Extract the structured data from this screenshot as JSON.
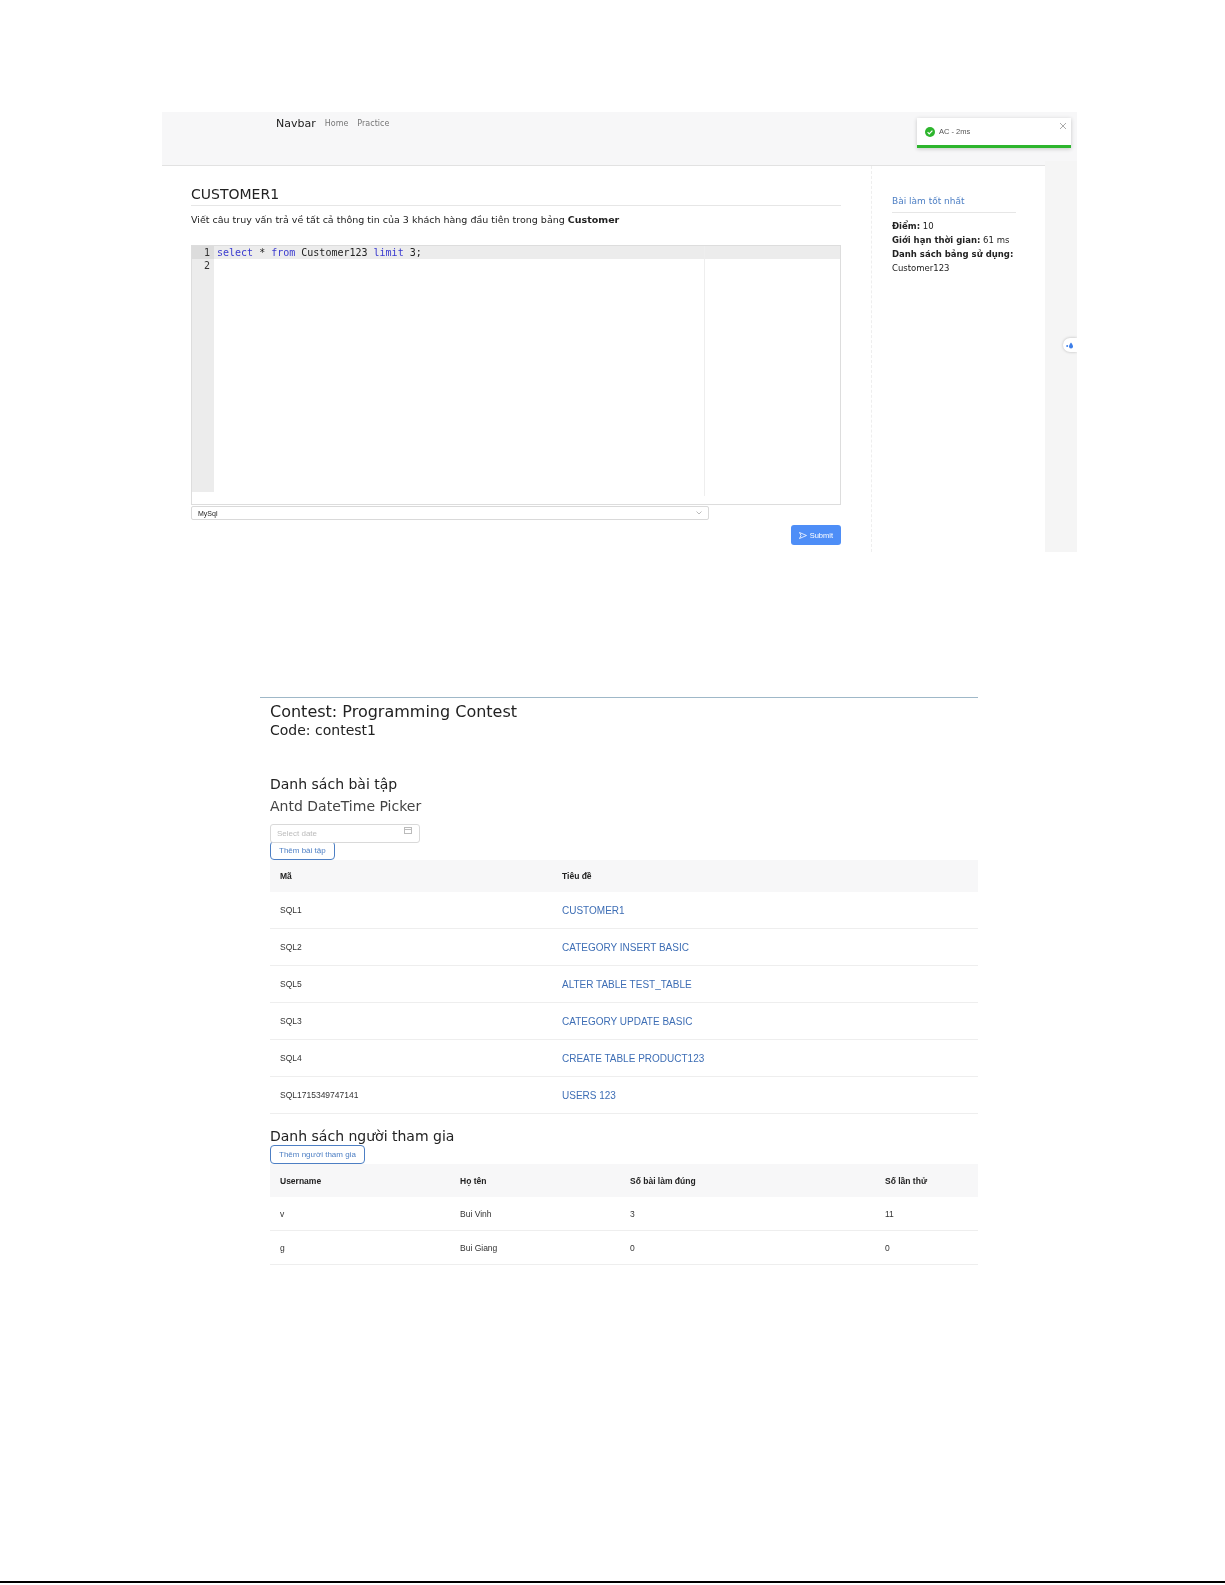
{
  "practice_screen": {
    "navbar": {
      "brand": "Navbar",
      "links": [
        {
          "label": "Home"
        },
        {
          "label": "Practice"
        }
      ]
    },
    "toast": {
      "kind": "success",
      "message": "AC - 2ms"
    },
    "problem": {
      "title": "CUSTOMER1",
      "description": "Viết câu truy vấn trả về tất cả thông tin của 3 khách hàng đầu tiên trong bảng **Customer**"
    },
    "editor": {
      "lines": [
        {
          "number": "1",
          "active": true,
          "tokens": [
            {
              "kind": "keyword",
              "text": "select"
            },
            {
              "kind": "plain",
              "text": " * "
            },
            {
              "kind": "keyword",
              "text": "from"
            },
            {
              "kind": "plain",
              "text": " Customer123 "
            },
            {
              "kind": "keyword",
              "text": "limit"
            },
            {
              "kind": "plain",
              "text": " 3;"
            }
          ]
        },
        {
          "number": "2",
          "active": false
        }
      ]
    },
    "language_select": {
      "value": "MySql"
    },
    "submit_button": {
      "label": "Submit"
    },
    "best_submission": {
      "title": "Bài làm tốt nhất",
      "lines": [
        "**Điểm:** 10",
        "**Giới hạn thời gian:** 61 ms",
        "**Danh sách bảng sử dụng:** Customer123"
      ]
    }
  },
  "contest_screen": {
    "title": "Contest: Programming Contest",
    "code": "Code: contest1",
    "problems_heading": "Danh sách bài tập",
    "picker_heading": "Antd DateTime Picker",
    "date_field": {
      "placeholder": "Select date"
    },
    "add_problem_button": "Thêm bài tập",
    "problems_table": {
      "columns": [
        "Mã",
        "Tiêu đề"
      ],
      "rows": [
        [
          "SQL1",
          "CUSTOMER1"
        ],
        [
          "SQL2",
          "CATEGORY INSERT BASIC"
        ],
        [
          "SQL5",
          "ALTER TABLE TEST_TABLE"
        ],
        [
          "SQL3",
          "CATEGORY UPDATE BASIC"
        ],
        [
          "SQL4",
          "CREATE TABLE PRODUCT123"
        ],
        [
          "SQL1715349747141",
          "USERS 123"
        ]
      ]
    },
    "participants_heading": "Danh sách người tham gia",
    "add_participant_button": "Thêm người tham gia",
    "participants_table": {
      "columns": [
        "Username",
        "Họ tên",
        "Số bài làm đúng",
        "Số lần thử"
      ],
      "rows": [
        [
          "v",
          "Bui Vinh",
          "3",
          "11"
        ],
        [
          "g",
          "Bui Giang",
          "0",
          "0"
        ]
      ]
    }
  }
}
